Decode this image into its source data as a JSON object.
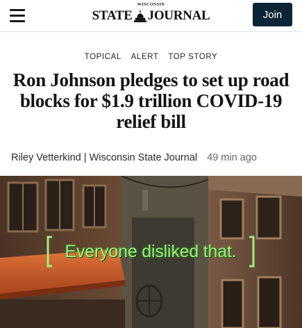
{
  "header": {
    "logo_top": "WISCONSIN",
    "logo_left": "STATE",
    "logo_right": "JOURNAL",
    "join_label": "Join"
  },
  "article": {
    "tags": [
      "TOPICAL",
      "ALERT",
      "TOP STORY"
    ],
    "headline_lines": [
      "Ron Johnson pledges to set up road",
      "blocks for $1.9 trillion COVID-19",
      "relief bill"
    ],
    "author": "Riley Vetterkind | Wisconsin State Journal",
    "time": "49 min ago"
  },
  "image": {
    "caption": "Everyone disliked that."
  },
  "colors": {
    "join_bg": "#0d2436",
    "caption_green": "#9cf07a"
  }
}
